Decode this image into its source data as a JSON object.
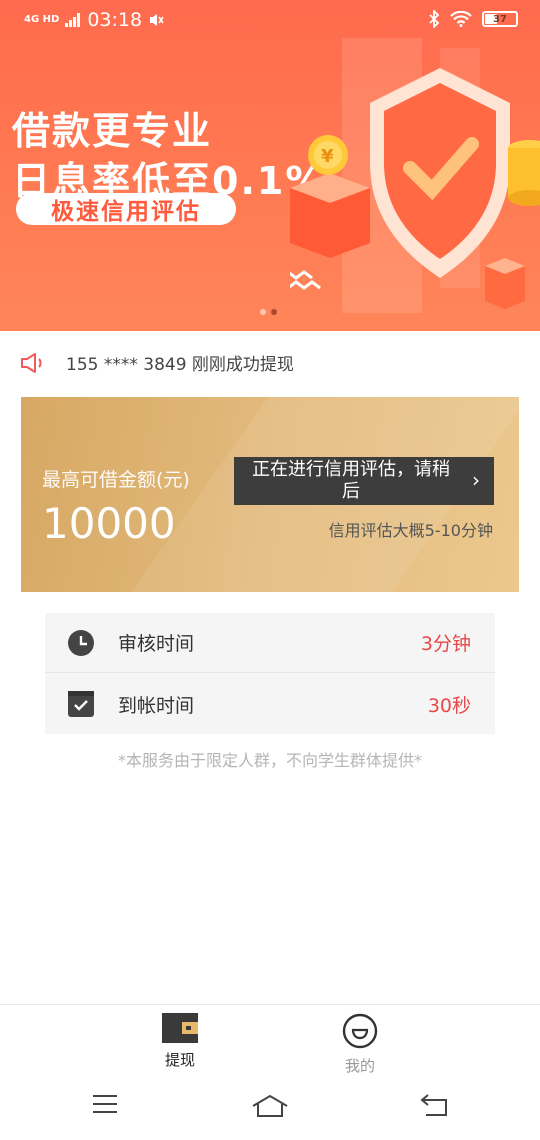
{
  "status": {
    "network": "4G HD",
    "time": "03:18",
    "battery": "37"
  },
  "banner": {
    "title_line1": "借款更专业",
    "title_line2": "日息率低至0.1%",
    "pill": "极速信用评估",
    "slides": 2,
    "active_slide": 2
  },
  "notice": {
    "text": "155 **** 3849 刚刚成功提现"
  },
  "loan_card": {
    "label": "最高可借金额(元)",
    "amount": "10000",
    "eval_button": "正在进行信用评估，请稍后",
    "hint": "信用评估大概5-10分钟"
  },
  "info": {
    "rows": [
      {
        "icon": "clock-icon",
        "label": "审核时间",
        "value": "3分钟"
      },
      {
        "icon": "checkbox-icon",
        "label": "到帐时间",
        "value": "30秒"
      }
    ]
  },
  "disclaimer": "*本服务由于限定人群，不向学生群体提供*",
  "tabs": [
    {
      "label": "提现",
      "icon": "wallet-icon",
      "active": true
    },
    {
      "label": "我的",
      "icon": "smiley-face-icon",
      "active": false
    }
  ],
  "colors": {
    "banner": "#ff6a4e",
    "card_gold": "#e3bb7e",
    "value_red": "#e84848"
  }
}
